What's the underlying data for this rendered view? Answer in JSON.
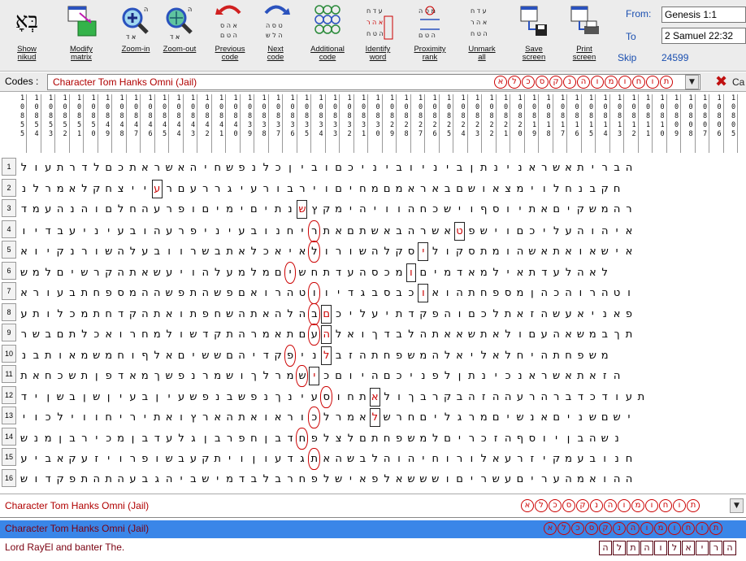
{
  "toolbar": {
    "buttons": [
      {
        "name": "show-nikud",
        "label": "Show\nnikud"
      },
      {
        "name": "modify-matrix",
        "label": "Modify\nmatrix"
      },
      {
        "name": "zoom-in",
        "label": "Zoom-in"
      },
      {
        "name": "zoom-out",
        "label": "Zoom-out"
      },
      {
        "name": "previous-code",
        "label": "Previous\ncode"
      },
      {
        "name": "next-code",
        "label": "Next\ncode"
      },
      {
        "name": "additional-code",
        "label": "Additional\ncode"
      },
      {
        "name": "identify-word",
        "label": "Identify\nword"
      },
      {
        "name": "proximity-rank",
        "label": "Proximity\nrank"
      },
      {
        "name": "unmark-all",
        "label": "Unmark\nall"
      },
      {
        "name": "save-screen",
        "label": "Save\nscreen"
      },
      {
        "name": "print-screen",
        "label": "Print\nscreen"
      }
    ],
    "nikud_glyph": "בְּאׇ",
    "from_label": "From:",
    "to_label": "To",
    "from_value": "Genesis 1:1",
    "to_value": "2 Samuel 22:32",
    "skip_label": "Skip",
    "skip_value": "24599"
  },
  "codes": {
    "label": "Codes :",
    "selected": "Character Tom Hanks Omni (Jail)",
    "letters": [
      "ת",
      "ו",
      "ח",
      "ו",
      "מ",
      "ו",
      "ה",
      "נ",
      "ק",
      "ס",
      "כ",
      "ל",
      "א"
    ],
    "cancel_label": "Ca"
  },
  "grid": {
    "columns": [
      "10855",
      "10854",
      "10853",
      "10852",
      "10851",
      "10850",
      "10849",
      "10848",
      "10847",
      "10846",
      "10845",
      "10844",
      "10843",
      "10842",
      "10841",
      "10840",
      "10839",
      "10838",
      "10837",
      "10836",
      "10835",
      "10834",
      "10833",
      "10832",
      "10831",
      "10830",
      "10829",
      "10828",
      "10827",
      "10826",
      "10825",
      "10824",
      "10823",
      "10822",
      "10821",
      "10820",
      "10819",
      "10818",
      "10817",
      "10816",
      "10815",
      "10814",
      "10813",
      "10812",
      "10811",
      "10810",
      "10809",
      "10808",
      "10807",
      "10806",
      "10805"
    ],
    "rows": [
      "הבריתאשראנינתןביניוביניכםוביןכלנפשחיהאשראתכםלדרתעול",
      "חקבנחלוימצאושםבאראמםמחיםוירבורעיגררעםרעייצחקלאמרלנ",
      "רהמשקיםאתיוסףוישכחהוויהימקץשנתיםימיםופרעהחלםוהנהעמד",
      "איהוהעליכםוישפטאשרהבאשתםאתריחנובעיניפרעהובעיניעבדיו",
      "אישאואתאשהומתסקוליסקלהשורולאיאכלאתבשרוובעלהשורנקיוא",
      "לאהלעדתאילמאדמיםומכסהעדתחשיםמלמעלהויעשאתהקרשיםלמש",
      "וטהרוהכהןמספחתהואוכבסבגדיווטהרואםפשהתפשההמספחתבעורא",
      "פאניאעשהזאתלכםוהפקדתיעליכםבהלהאתהשחפתואתהקדחתמכלותע",
      "תךבמשאהעםולאתשאאתהלבדךואלהעםתאמרהתקדשולמחרואכלתםבשר",
      "משפחתהיחלאליאלהמשפחתהזבלניפקדיהםששיםאלףוחמשמאותבנ",
      "הזאתאשראנכינתןלפניכםהיוםכישמרלךושמרנפשךמאדפןתשכחאת",
      "תעודכדברהרעההזהבקרבךולאתחוסעינךנפשבנפשעיןבעיןשןבשןיד",
      "ישםשניםאנשיםמרגליםחרשלאמרלכוראואתהארץואתיריחווילכוי",
      "נשהבןיוסףהזכריםלמשפחתםלצלפחדבןחפרבןגלעדבןמכירבןמנש",
      "חנובעמקיזרעאלורוחיהוהלבשהאתגדעוןויתקעבשופרויזעקאביע",
      "ההואמהעריםעשריםושששאלפאישלפחרבלבדמישביהגבעהתהתפקדוש"
    ],
    "marked": [
      [
        1,
        38
      ],
      [
        2,
        27
      ],
      [
        3,
        14
      ],
      [
        4,
        17
      ],
      [
        5,
        16
      ],
      [
        6,
        17
      ],
      [
        7,
        25
      ],
      [
        8,
        25
      ],
      [
        9,
        23
      ],
      [
        10,
        25
      ],
      [
        11,
        22
      ],
      [
        12,
        21
      ]
    ],
    "oval_col": 26
  },
  "lists": {
    "row1": "Character Tom Hanks Omni (Jail)",
    "row1_letters": [
      "ת",
      "ו",
      "ח",
      "ו",
      "מ",
      "ו",
      "ה",
      "נ",
      "ק",
      "ס",
      "כ",
      "ל",
      "א"
    ],
    "row2": "Character Tom Hanks Omni (Jail)",
    "row2_letters": [
      "ת",
      "ו",
      "ח",
      "ו",
      "מ",
      "ו",
      "ה",
      "נ",
      "ק",
      "ס",
      "כ",
      "ל",
      "א"
    ],
    "row3": "Lord RayEl and banter The.",
    "row3_letters": [
      "ה",
      "ר",
      "י",
      "א",
      "ל",
      "ו",
      "ה",
      "ת",
      "ל",
      "ה"
    ]
  }
}
